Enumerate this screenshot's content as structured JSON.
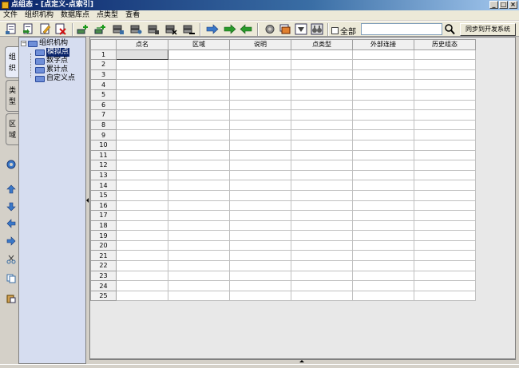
{
  "window": {
    "title": "点组态 - [点定义-点索引]",
    "min": "_",
    "max": "□",
    "close": "×"
  },
  "menu": [
    "文件",
    "组织机构",
    "数据库点",
    "点类型",
    "查看"
  ],
  "toolbar": {
    "checkbox_label": "全部",
    "search_value": "",
    "sync_label": "同步到开发系统"
  },
  "left_tabs": [
    "组织",
    "类型",
    "区域"
  ],
  "side_icons": [
    "refresh-icon",
    "arrow-up-icon",
    "arrow-down-icon",
    "arrow-left-icon",
    "arrow-right-icon",
    "cut-icon",
    "copy-icon",
    "paste-icon"
  ],
  "tree": {
    "root": "组织机构",
    "expander": "−",
    "children": [
      "模拟点",
      "数字点",
      "累计点",
      "自定义点"
    ],
    "selected": "模拟点"
  },
  "grid": {
    "columns": [
      "点名",
      "区域",
      "说明",
      "点类型",
      "外部连接",
      "历史组态"
    ],
    "rows": [
      "1",
      "2",
      "3",
      "4",
      "5",
      "6",
      "7",
      "8",
      "9",
      "10",
      "11",
      "12",
      "13",
      "14",
      "15",
      "16",
      "17",
      "18",
      "19",
      "20",
      "21",
      "22",
      "23",
      "24",
      "25"
    ]
  }
}
